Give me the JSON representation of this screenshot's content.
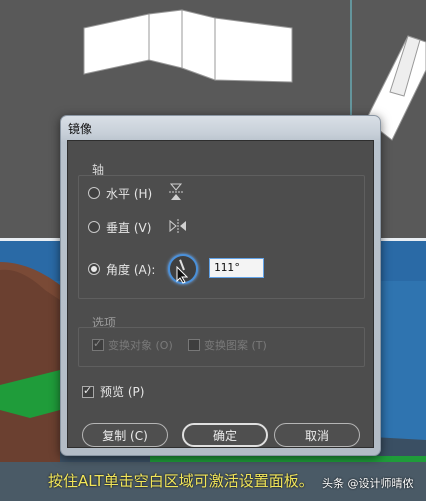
{
  "dialog": {
    "title": "镜像",
    "axis_group": "轴",
    "options_group": "选项",
    "radios": [
      {
        "label": "水平 (H)",
        "checked": false,
        "icon": "flip-horizontal-axis-icon"
      },
      {
        "label": "垂直 (V)",
        "checked": false,
        "icon": "flip-vertical-axis-icon"
      },
      {
        "label": "角度 (A):",
        "checked": true,
        "icon": "angle-dial-icon"
      }
    ],
    "angle_value": "111°",
    "options": [
      {
        "label": "变换对象 (O)",
        "checked": true,
        "enabled": false
      },
      {
        "label": "变换图案 (T)",
        "checked": false,
        "enabled": false
      }
    ],
    "preview_label": "预览 (P)",
    "preview_checked": true,
    "buttons": {
      "copy": "复制 (C)",
      "ok": "确定",
      "cancel": "取消"
    }
  },
  "caption": "按住ALT单击空白区域可激活设置面板。",
  "watermark": "头条 @设计师晴侬",
  "colors": {
    "background_gray": "#595959",
    "sky_blue": "#2f74b0",
    "mountain_brown": "#7a4a36",
    "grass_green": "#1f9c3a",
    "caption_yellow": "#f2e65a",
    "accent_blue": "#4a90d9"
  }
}
